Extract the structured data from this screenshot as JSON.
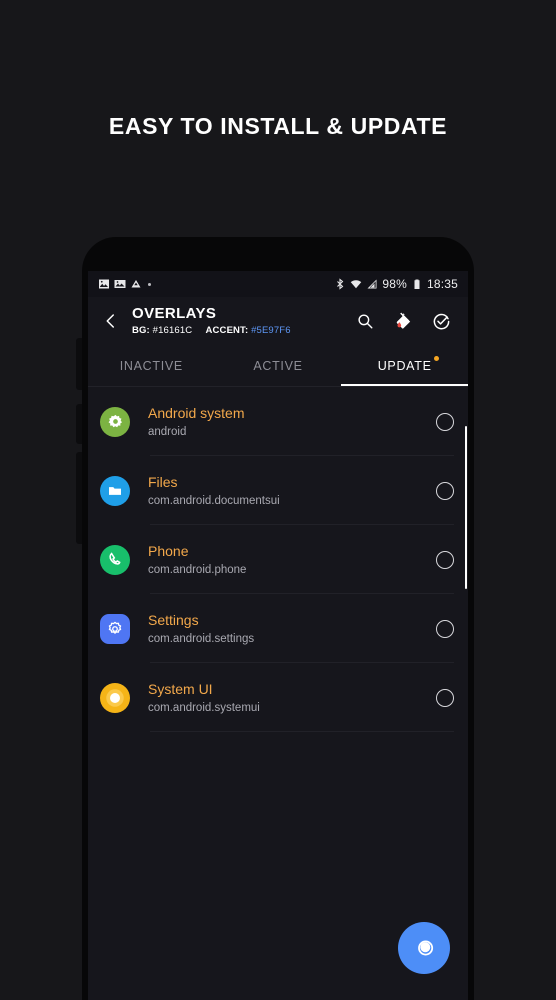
{
  "promo": {
    "headline": "EASY TO INSTALL & UPDATE"
  },
  "status_bar": {
    "icons_left": [
      "image-icon",
      "screenshot-icon",
      "drive-icon",
      "dot-icon"
    ],
    "bluetooth_icon": "bluetooth-icon",
    "wifi_icon": "wifi-icon",
    "signal_icon": "signal-icon",
    "battery_percent": "98%",
    "battery_icon": "battery-icon",
    "clock": "18:35"
  },
  "toolbar": {
    "back_icon": "back-arrow-icon",
    "title": "OVERLAYS",
    "subtitle": {
      "bg_label": "BG:",
      "bg_value": "#16161C",
      "accent_label": "ACCENT:",
      "accent_value": "#5E97F6"
    },
    "actions": [
      {
        "name": "search-icon",
        "label": "Search"
      },
      {
        "name": "paint-bucket-icon",
        "label": "Theme colors"
      },
      {
        "name": "refresh-check-icon",
        "label": "Update all"
      }
    ]
  },
  "tabs": [
    {
      "label": "INACTIVE",
      "selected": false,
      "badge": false
    },
    {
      "label": "ACTIVE",
      "selected": false,
      "badge": false
    },
    {
      "label": "UPDATE",
      "selected": true,
      "badge": true
    }
  ],
  "list": [
    {
      "title": "Android system",
      "package": "android",
      "icon": "android-system-gear-icon",
      "icon_bg": "#7CB342",
      "checked": false
    },
    {
      "title": "Files",
      "package": "com.android.documentsui",
      "icon": "files-folder-icon",
      "icon_bg": "#1F9FE8",
      "checked": false
    },
    {
      "title": "Phone",
      "package": "com.android.phone",
      "icon": "phone-handset-icon",
      "icon_bg": "#18BF6B",
      "checked": false
    },
    {
      "title": "Settings",
      "package": "com.android.settings",
      "icon": "settings-gear-icon",
      "icon_bg": "#4F76F3",
      "checked": false
    },
    {
      "title": "System UI",
      "package": "com.android.systemui",
      "icon": "system-ui-circle-icon",
      "icon_bg": "#F5B417",
      "checked": false
    }
  ],
  "fab": {
    "icon": "apply-overlays-icon",
    "color": "#4D8EF7"
  },
  "colors": {
    "screen_bg": "#16161C",
    "accent": "#5E97F6",
    "title_orange": "#F2A84B",
    "badge_orange": "#F5A623"
  }
}
